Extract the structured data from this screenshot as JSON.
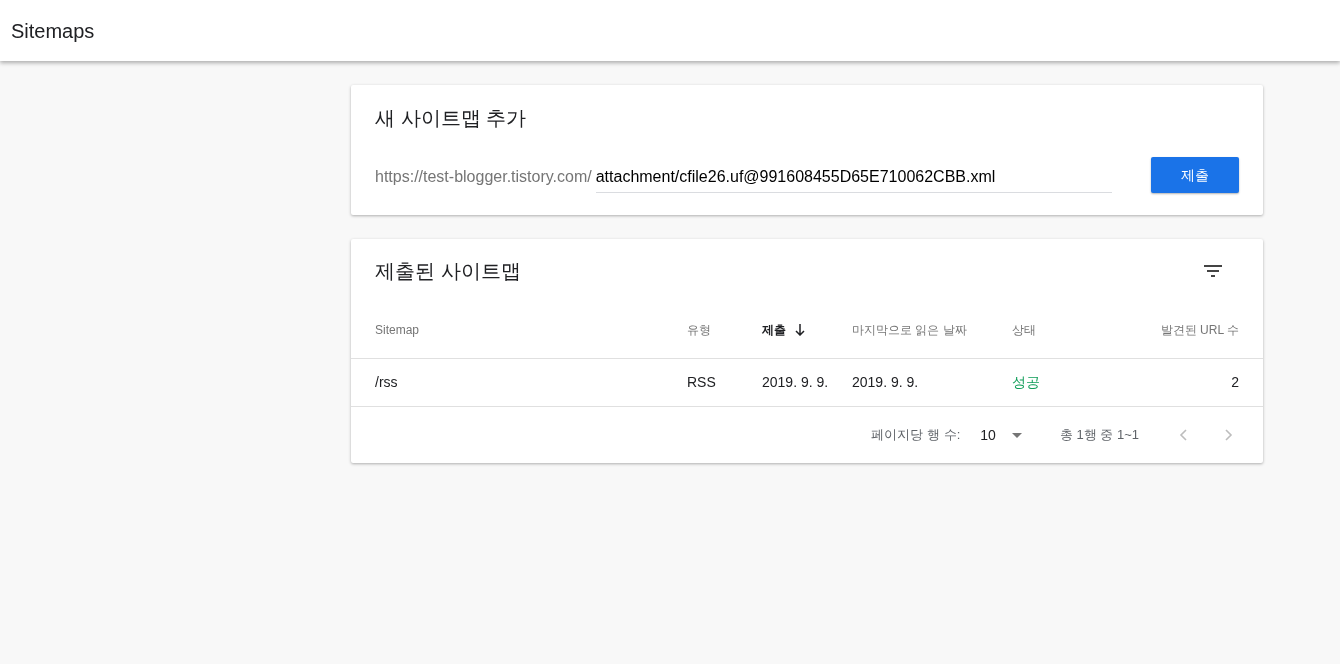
{
  "app_bar": {
    "title": "Sitemaps"
  },
  "add_card": {
    "title": "새 사이트맵 추가",
    "url_prefix": "https://test-blogger.tistory.com/",
    "input_value": "attachment/cfile26.uf@991608455D65E710062CBB.xml",
    "submit_button": "제출"
  },
  "submitted_card": {
    "title": "제출된 사이트맵",
    "table": {
      "columns": [
        {
          "label": "Sitemap",
          "selected": false
        },
        {
          "label": "유형",
          "selected": false
        },
        {
          "label": "제출",
          "selected": true
        },
        {
          "label": "마지막으로 읽은 날짜",
          "selected": false
        },
        {
          "label": "상태",
          "selected": false
        },
        {
          "label": "발견된 URL 수",
          "selected": false
        }
      ],
      "rows": [
        {
          "sitemap": "/rss",
          "type": "RSS",
          "submitted": "2019. 9. 9.",
          "last_read": "2019. 9. 9.",
          "status": "성공",
          "color": "#0f9d58",
          "urls": "2"
        }
      ]
    },
    "pagination": {
      "rows_per_page_label": "페이지당 행 수:",
      "rows_per_page": "10",
      "range": "총 1행 중 1~1"
    }
  }
}
